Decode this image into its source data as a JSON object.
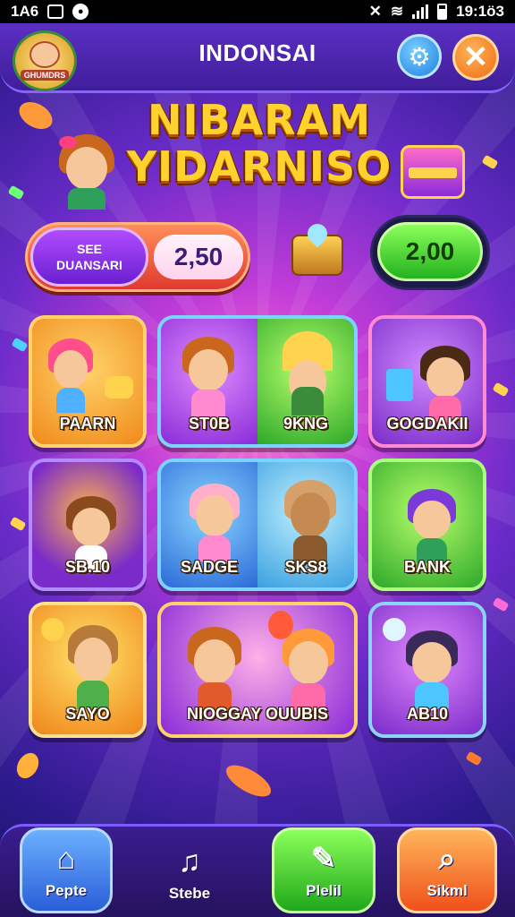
{
  "status_bar": {
    "left_text": "1A6",
    "time": "19:1ö3"
  },
  "header": {
    "logo_text": "GHUMDRS",
    "title": "INDONSAI",
    "settings_icon": "settings-icon",
    "close_icon": "close-icon",
    "close_glyph": "✕"
  },
  "game_title": {
    "line1": "NIBARAM",
    "line2": "YIDARNISO"
  },
  "currency": {
    "button_line1": "SEE",
    "button_line2": "DUANSARI",
    "coins": "2,50",
    "gems": "2,00"
  },
  "cards": [
    {
      "label": "PAARN"
    },
    {
      "label_left": "ST0B",
      "label_right": "9KNG"
    },
    {
      "label": "GOGDAKII"
    },
    {
      "label": "SB.10"
    },
    {
      "label_left": "SADGE",
      "label_right": "SKS8"
    },
    {
      "label": "BANK"
    },
    {
      "label": "SAYO"
    },
    {
      "label": "NIOGGAY OUUBIS"
    },
    {
      "label": "AB10"
    }
  ],
  "bottom_nav": [
    {
      "label": "Pepte",
      "icon": "home-icon",
      "glyph": "⌂",
      "color": "#3b7dff"
    },
    {
      "label": "Stebe",
      "icon": "music-icon",
      "glyph": "♫",
      "color": "#3a1d8f"
    },
    {
      "label": "Plelil",
      "icon": "clipboard-icon",
      "glyph": "✎",
      "color": "#2fc23a"
    },
    {
      "label": "Sikml",
      "icon": "search-icon",
      "glyph": "⌕",
      "color": "#ff5a1f"
    }
  ]
}
